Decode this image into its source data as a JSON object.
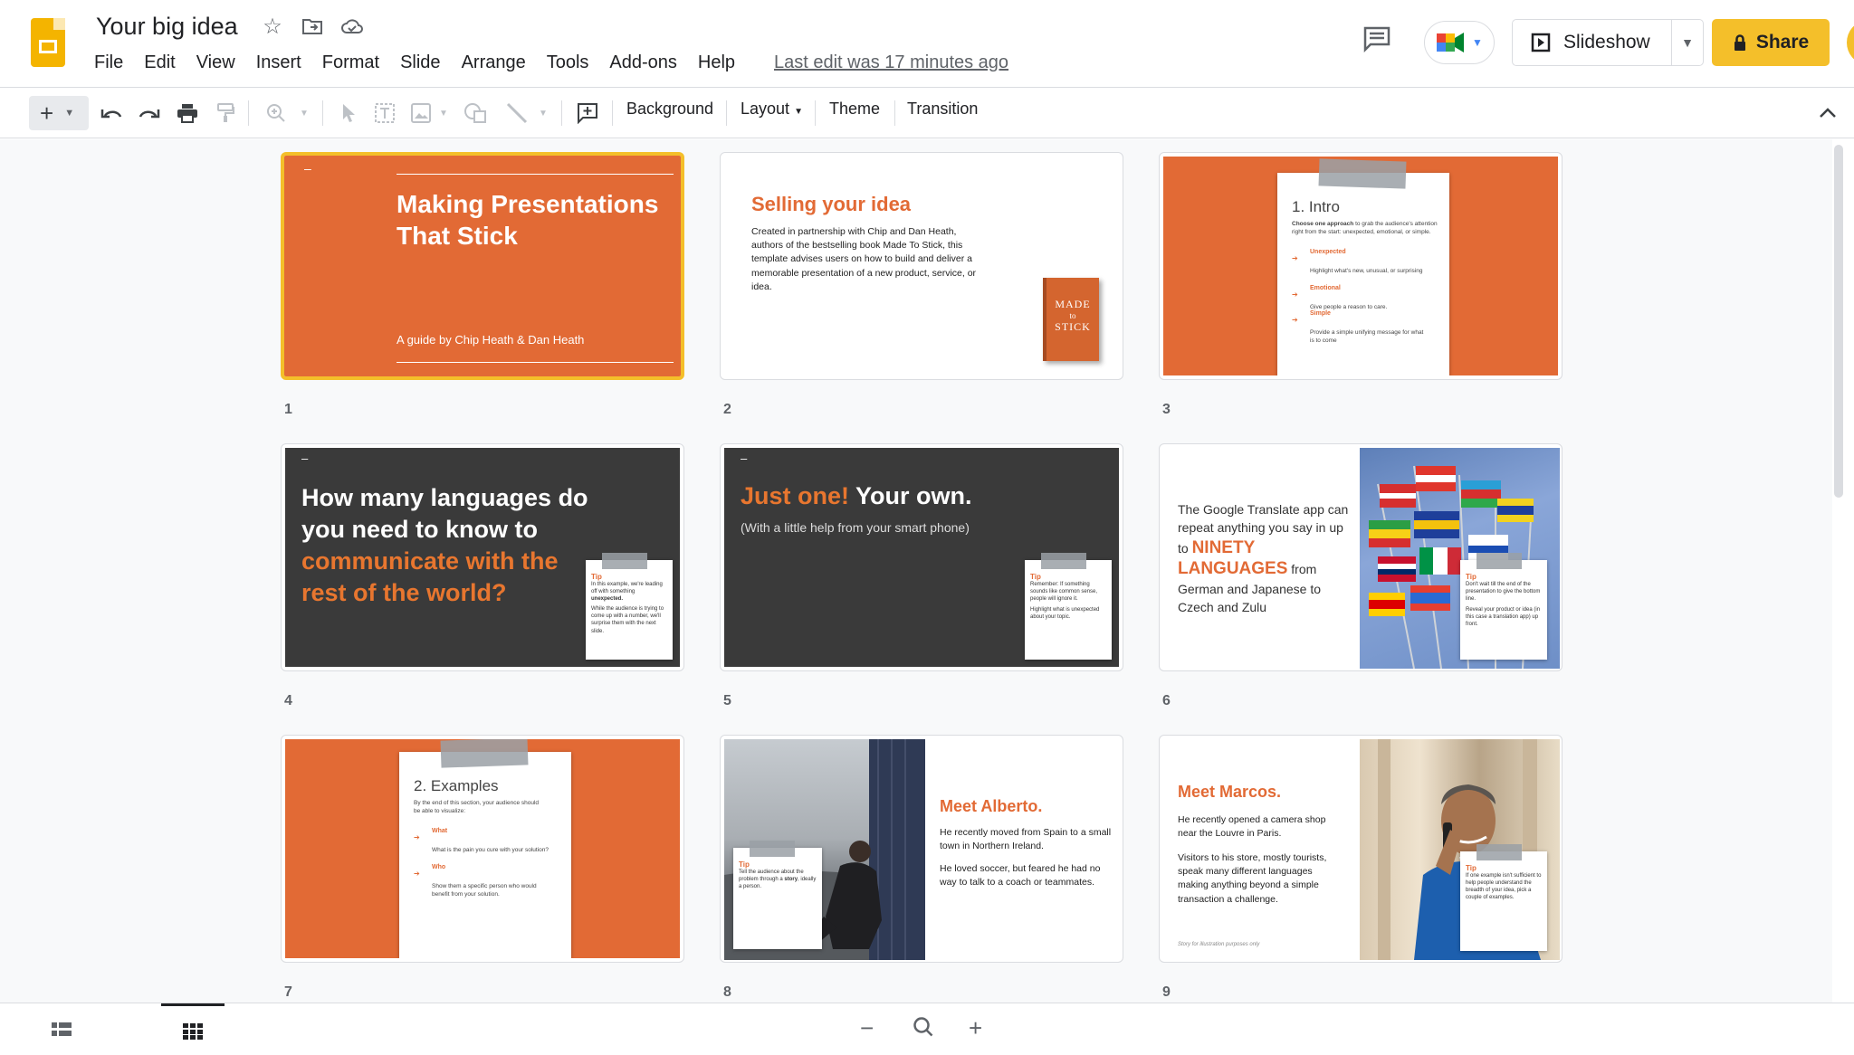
{
  "app": {
    "doc_title": "Your big idea",
    "last_edit": "Last edit was 17 minutes ago",
    "slideshow_label": "Slideshow",
    "share_label": "Share"
  },
  "menu": [
    "File",
    "Edit",
    "View",
    "Insert",
    "Format",
    "Slide",
    "Arrange",
    "Tools",
    "Add-ons",
    "Help"
  ],
  "toolbar": {
    "background": "Background",
    "layout": "Layout",
    "theme": "Theme",
    "transition": "Transition"
  },
  "colors": {
    "accent_orange": "#e26a35",
    "dark_slide": "#3a3a3a",
    "share_yellow": "#f4bf2a",
    "selection": "#f4bf2a"
  },
  "slides": [
    {
      "number": "1",
      "dash": "–",
      "title": "Making Presentations That Stick",
      "subtitle": "A guide by Chip Heath & Dan Heath"
    },
    {
      "number": "2",
      "title": "Selling your idea",
      "body": "Created in partnership with Chip and Dan Heath, authors of the bestselling book Made To Stick, this template advises users on how to build and deliver a memorable presentation of a new product, service, or idea.",
      "book": [
        "MADE",
        "to",
        "STICK"
      ]
    },
    {
      "number": "3",
      "title": "1. Intro",
      "lead_bold": "Choose one approach",
      "lead": " to grab the audience's attention right from the start: unexpected, emotional, or simple.",
      "items": [
        {
          "label": "Unexpected",
          "text": "Highlight what's new, unusual, or surprising"
        },
        {
          "label": "Emotional",
          "text": "Give people a reason to care."
        },
        {
          "label": "Simple",
          "text": "Provide a simple unifying message for what is to come"
        }
      ]
    },
    {
      "number": "4",
      "dash": "–",
      "title_white": "How many languages do you need to know to",
      "title_orange": "communicate with the rest of the world?",
      "tip_head": "Tip",
      "tip_1": "In this example, we're leading off with something",
      "tip_1_bold": "unexpected.",
      "tip_2": "While the audience is trying to come up with a number, we'll surprise them with the next slide."
    },
    {
      "number": "5",
      "dash": "–",
      "title_orange": "Just one!",
      "title_white": " Your own.",
      "subtitle": "(With a little help from your smart phone)",
      "tip_head": "Tip",
      "tip_1": "Remember: If something sounds like common sense, people will ignore it.",
      "tip_2": "Highlight what is unexpected about your topic."
    },
    {
      "number": "6",
      "text_1": "The Google Translate app can repeat anything you say in up to",
      "highlight": "NINETY LANGUAGES",
      "text_2": "from German and Japanese  to Czech and Zulu",
      "tip_head": "Tip",
      "tip_1": "Don't wait till the end of the presentation to give the bottom line.",
      "tip_2": "Reveal your product or idea (in this case a translation app) up front."
    },
    {
      "number": "7",
      "title": "2. Examples",
      "lead": "By the end of this section, your audience should be able to visualize:",
      "items": [
        {
          "label": "What",
          "text": "What is the pain you cure with your solution?"
        },
        {
          "label": "Who",
          "text": "Show them a specific person who would benefit from your solution."
        }
      ]
    },
    {
      "number": "8",
      "title": "Meet Alberto.",
      "p1": "He recently moved from Spain to a small town in Northern Ireland.",
      "p2": "He loved soccer, but feared he had no way to talk to a coach or teammates.",
      "tip_head": "Tip",
      "tip_1": "Tell the audience about the problem through a",
      "tip_bold": "story",
      "tip_2": ", ideally a person."
    },
    {
      "number": "9",
      "title": "Meet Marcos.",
      "p1": "He recently opened a camera shop near the Louvre in Paris.",
      "p2": "Visitors to his store, mostly tourists, speak many different languages making anything beyond a simple transaction a challenge.",
      "footnote": "Story for illustration purposes only",
      "tip_head": "Tip",
      "tip_1": "If one example isn't sufficient to help people understand the breadth of your idea, pick a couple of examples."
    }
  ]
}
